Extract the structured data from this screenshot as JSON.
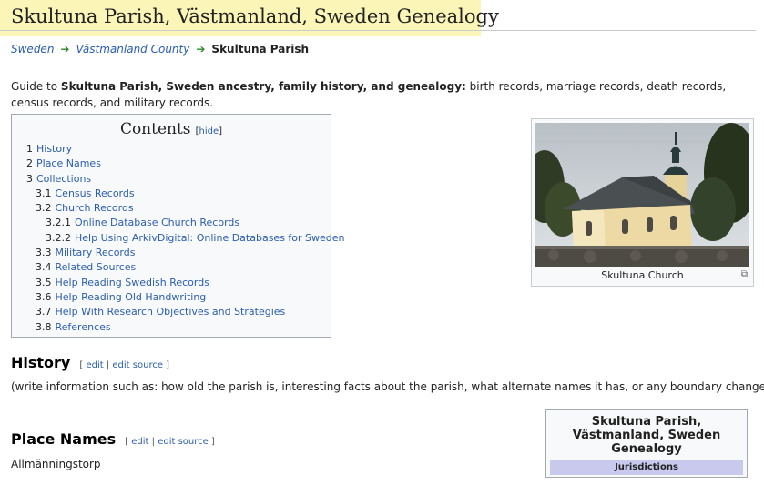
{
  "page": {
    "title": "Skultuna Parish, Västmanland, Sweden Genealogy"
  },
  "breadcrumb": {
    "items": [
      "Sweden",
      "Västmanland County"
    ],
    "current": "Skultuna Parish"
  },
  "intro": {
    "prefix": "Guide to ",
    "bold": "Skultuna Parish, Sweden ancestry, family history, and genealogy:",
    "suffix": " birth records, marriage records, death records, census records, and military records."
  },
  "toc": {
    "title": "Contents",
    "hide_label": "hide",
    "items": [
      {
        "num": "1",
        "label": "History"
      },
      {
        "num": "2",
        "label": "Place Names"
      },
      {
        "num": "3",
        "label": "Collections"
      },
      {
        "num": "3.1",
        "label": "Census Records"
      },
      {
        "num": "3.2",
        "label": "Church Records"
      },
      {
        "num": "3.2.1",
        "label": "Online Database Church Records"
      },
      {
        "num": "3.2.2",
        "label": "Help Using ArkivDigital: Online Databases for Sweden"
      },
      {
        "num": "3.3",
        "label": "Military Records"
      },
      {
        "num": "3.4",
        "label": "Related Sources"
      },
      {
        "num": "3.5",
        "label": "Help Reading Swedish Records"
      },
      {
        "num": "3.6",
        "label": "Help Reading Old Handwriting"
      },
      {
        "num": "3.7",
        "label": "Help With Research Objectives and Strategies"
      },
      {
        "num": "3.8",
        "label": "References"
      }
    ]
  },
  "image": {
    "caption": "Skultuna Church",
    "magnify_icon": "⧉"
  },
  "edit_links": {
    "edit": "edit",
    "separator": "|",
    "edit_source": "edit source"
  },
  "sections": {
    "history": {
      "heading": "History",
      "text": "(write information such as: how old the parish is, interesting facts about the parish, what alternate names it has, or any boundary changes.)"
    },
    "place_names": {
      "heading": "Place Names",
      "text": "Allmänningstorp"
    }
  },
  "infobox": {
    "title": "Skultuna Parish, Västmanland, Sweden Genealogy",
    "header": "Jurisdictions"
  },
  "colors": {
    "title_highlight": "#fbf6b8",
    "link": "#2a5db0",
    "breadcrumb_arrow": "#2e8b2e",
    "infobox_header": "#c9c9ee"
  }
}
